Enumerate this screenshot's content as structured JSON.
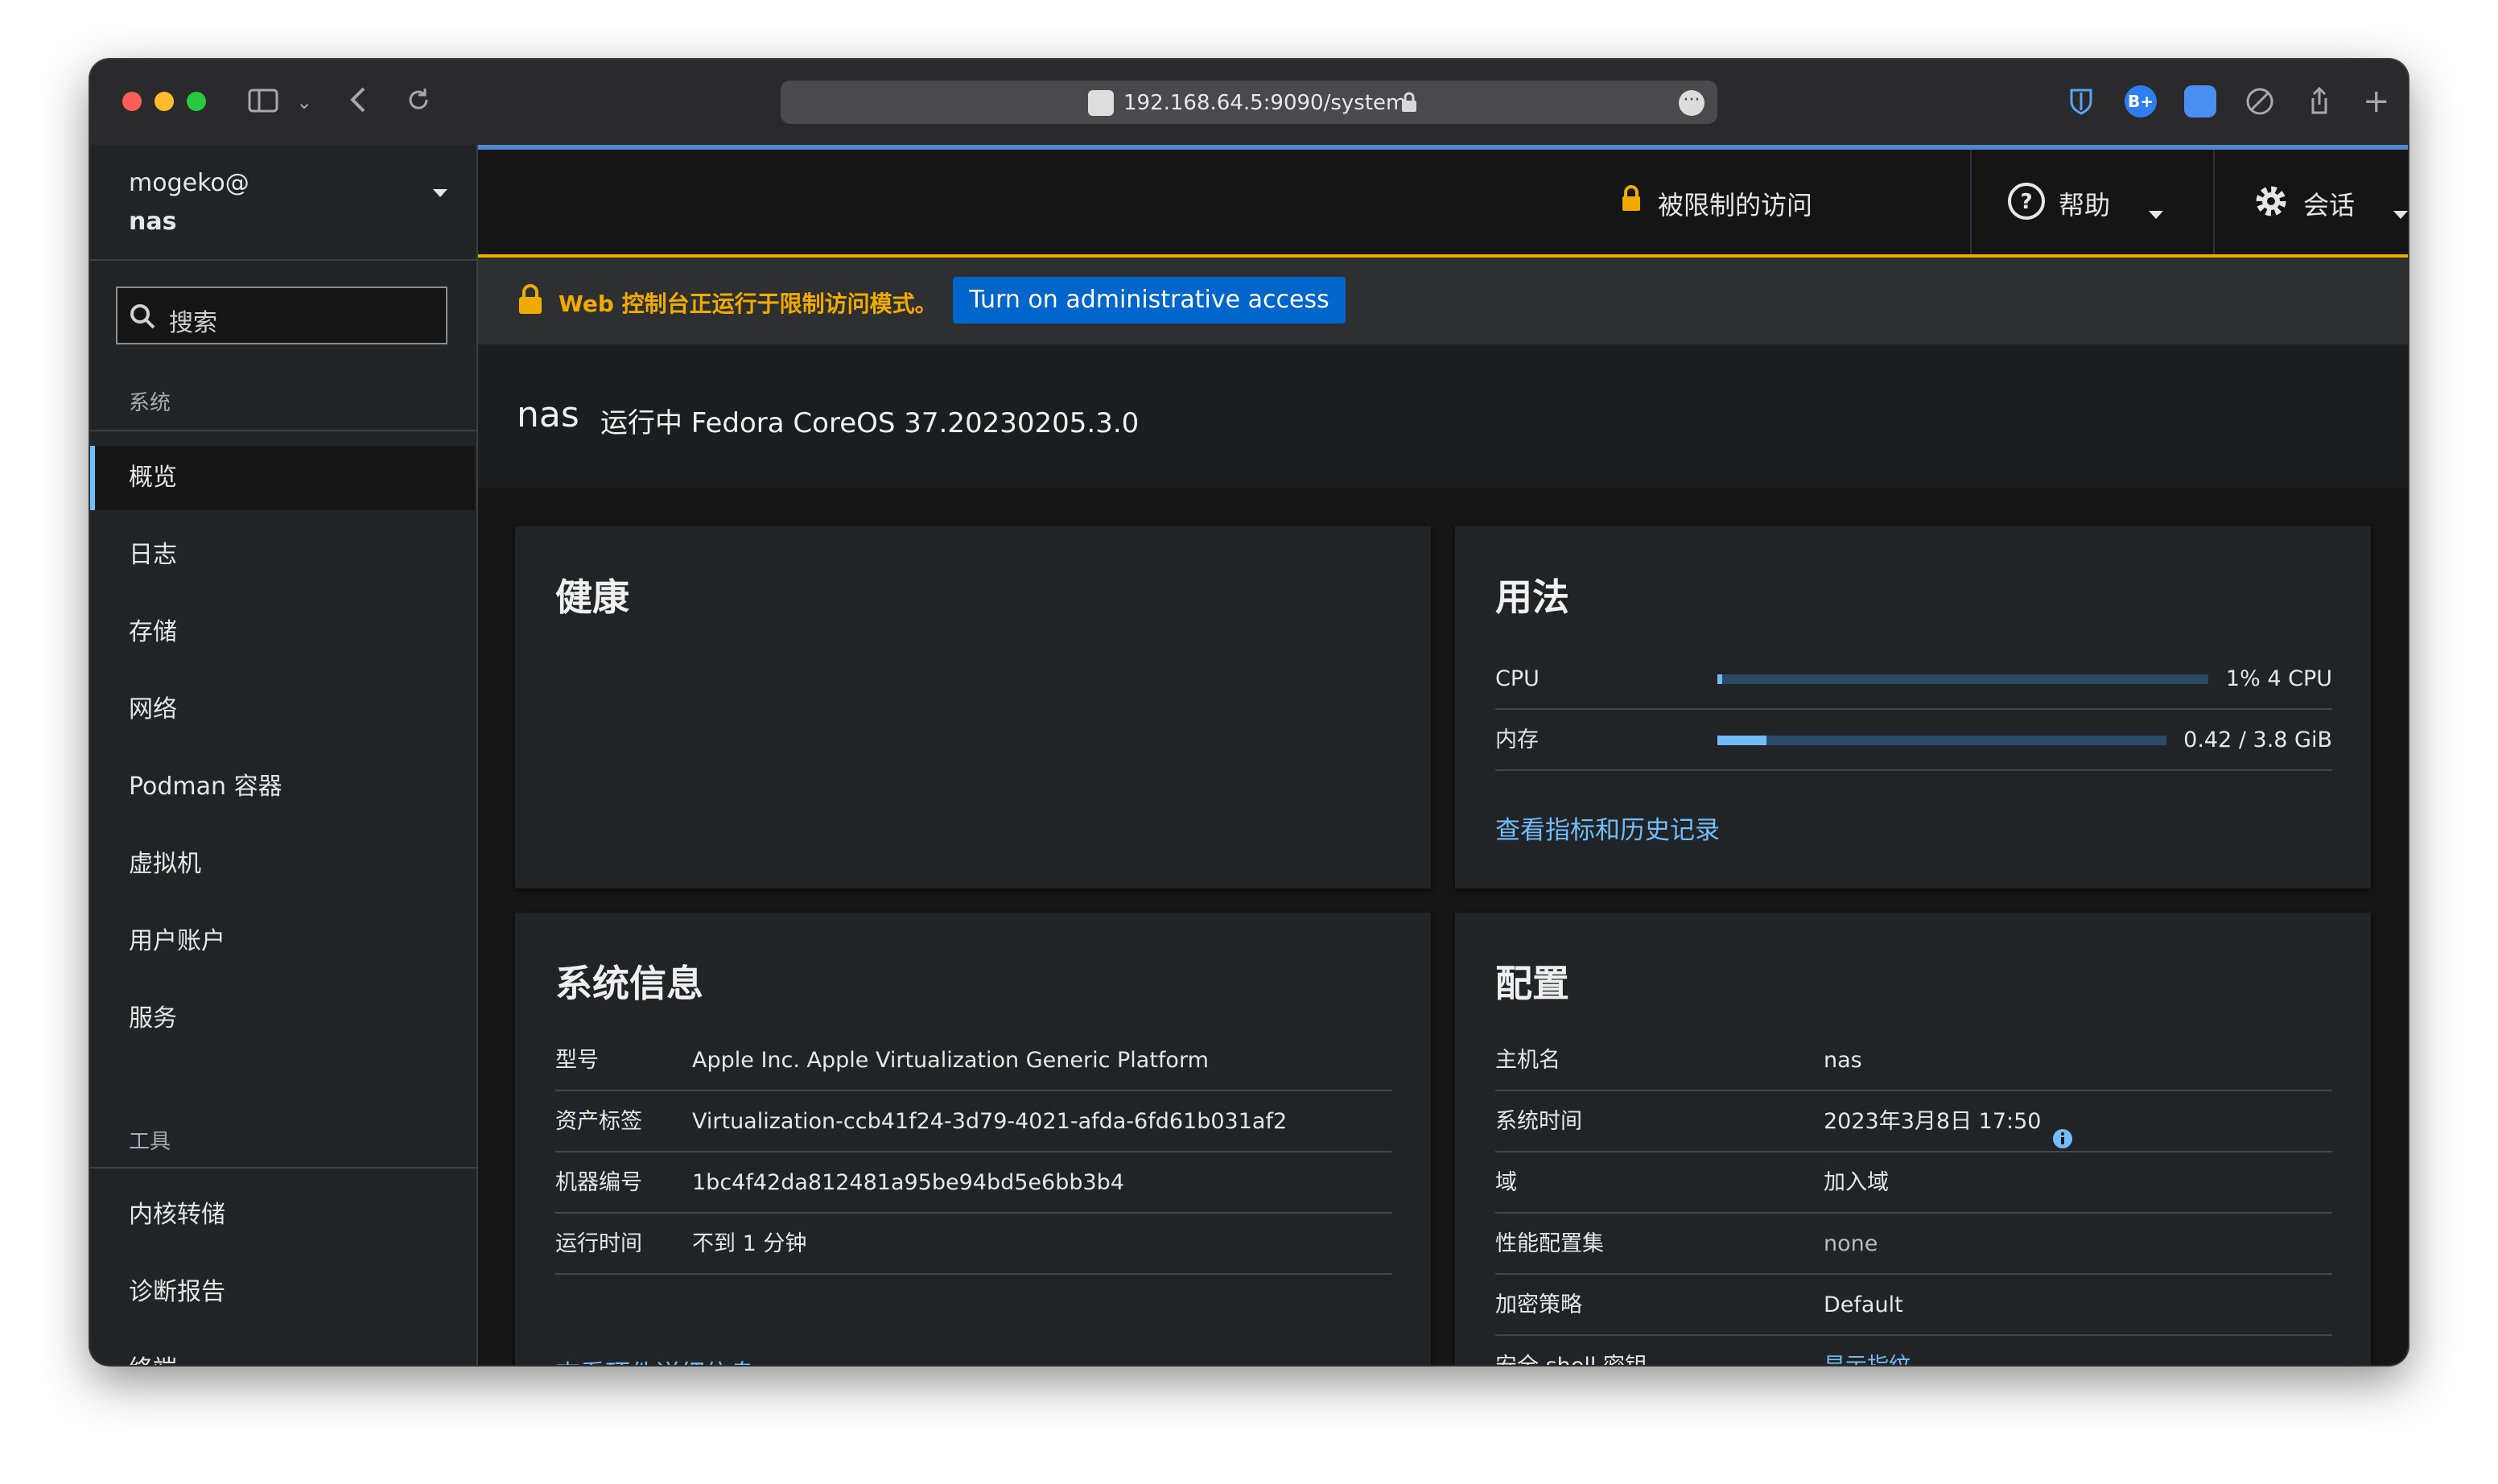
{
  "browser": {
    "url": "192.168.64.5:9090/system"
  },
  "sidebar": {
    "user": "mogeko@",
    "host": "nas",
    "search_placeholder": "搜索",
    "section_system": "系统",
    "items": [
      {
        "label": "概览"
      },
      {
        "label": "日志"
      },
      {
        "label": "存储"
      },
      {
        "label": "网络"
      },
      {
        "label": "Podman 容器"
      },
      {
        "label": "虚拟机"
      },
      {
        "label": "用户账户"
      },
      {
        "label": "服务"
      }
    ],
    "section_tools": "工具",
    "tools": [
      {
        "label": "内核转储"
      },
      {
        "label": "诊断报告"
      },
      {
        "label": "终端"
      }
    ]
  },
  "topnav": {
    "restricted": "被限制的访问",
    "help": "帮助",
    "session": "会话"
  },
  "alert": {
    "message": "Web 控制台正运行于限制访问模式。",
    "button": "Turn on administrative access"
  },
  "page": {
    "host": "nas",
    "subtitle": "运行中 Fedora CoreOS 37.20230205.3.0"
  },
  "health": {
    "title": "健康"
  },
  "usage": {
    "title": "用法",
    "rows": [
      {
        "label": "CPU",
        "value": "1% 4 CPU",
        "fraction": 0.01
      },
      {
        "label": "内存",
        "value": "0.42 / 3.8 GiB",
        "fraction": 0.11
      }
    ],
    "link": "查看指标和历史记录"
  },
  "sysinfo": {
    "title": "系统信息",
    "rows": [
      {
        "key": "型号",
        "value": "Apple Inc. Apple Virtualization Generic Platform"
      },
      {
        "key": "资产标签",
        "value": "Virtualization-ccb41f24-3d79-4021-afda-6fd61b031af2"
      },
      {
        "key": "机器编号",
        "value": "1bc4f42da812481a95be94bd5e6bb3b4"
      },
      {
        "key": "运行时间",
        "value": "不到 1 分钟"
      }
    ],
    "link": "查看硬件详细信息"
  },
  "config": {
    "title": "配置",
    "rows": [
      {
        "key": "主机名",
        "value": "nas"
      },
      {
        "key": "系统时间",
        "value": "2023年3月8日 17:50"
      },
      {
        "key": "域",
        "value": "加入域"
      },
      {
        "key": "性能配置集",
        "value": "none"
      },
      {
        "key": "加密策略",
        "value": "Default"
      },
      {
        "key": "安全 shell 密钥",
        "value": "显示指纹"
      }
    ]
  },
  "colors": {
    "accent": "#73bcf7",
    "warning": "#f0ab00",
    "button": "#0066cc"
  }
}
